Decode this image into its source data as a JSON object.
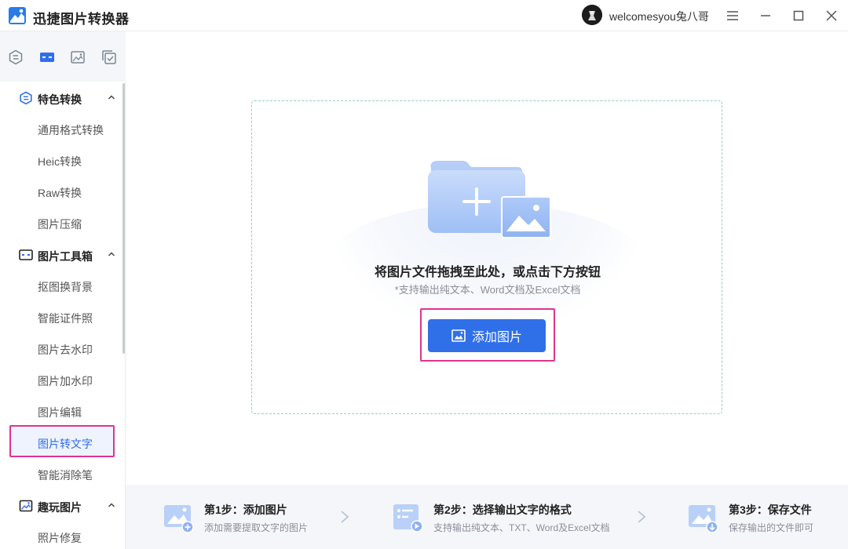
{
  "app": {
    "title": "迅捷图片转换器",
    "user_name": "welcomesyou兔八哥"
  },
  "titlebar_buttons": [
    "menu-icon",
    "minimize-icon",
    "maximize-icon",
    "close-icon"
  ],
  "tool_tabs": [
    "convert-icon",
    "toolbox-icon",
    "image-fun-icon",
    "batch-icon"
  ],
  "sidebar": {
    "groups": [
      {
        "title": "特色转换",
        "icon": "convert-icon",
        "items": [
          "通用格式转换",
          "Heic转换",
          "Raw转换",
          "图片压缩"
        ]
      },
      {
        "title": "图片工具箱",
        "icon": "toolbox-icon",
        "items": [
          "抠图换背景",
          "智能证件照",
          "图片去水印",
          "图片加水印",
          "图片编辑",
          "图片转文字",
          "智能消除笔"
        ]
      },
      {
        "title": "趣玩图片",
        "icon": "image-fun-icon",
        "items": [
          "照片修复"
        ]
      }
    ],
    "active_item": "图片转文字"
  },
  "dropzone": {
    "title": "将图片文件拖拽至此处，或点击下方按钮",
    "subtitle": "*支持输出纯文本、Word文档及Excel文档",
    "button_label": "添加图片"
  },
  "steps": [
    {
      "title": "第1步：添加图片",
      "desc": "添加需要提取文字的图片",
      "icon": "add-image-icon"
    },
    {
      "title": "第2步：选择输出文字的格式",
      "desc": "支持输出纯文本、TXT、Word及Excel文档",
      "icon": "format-icon"
    },
    {
      "title": "第3步：保存文件",
      "desc": "保存输出的文件即可",
      "icon": "save-icon"
    }
  ],
  "colors": {
    "accent": "#2f6fe8",
    "highlight": "#e0338f",
    "dashed_border": "#98cdc6"
  }
}
